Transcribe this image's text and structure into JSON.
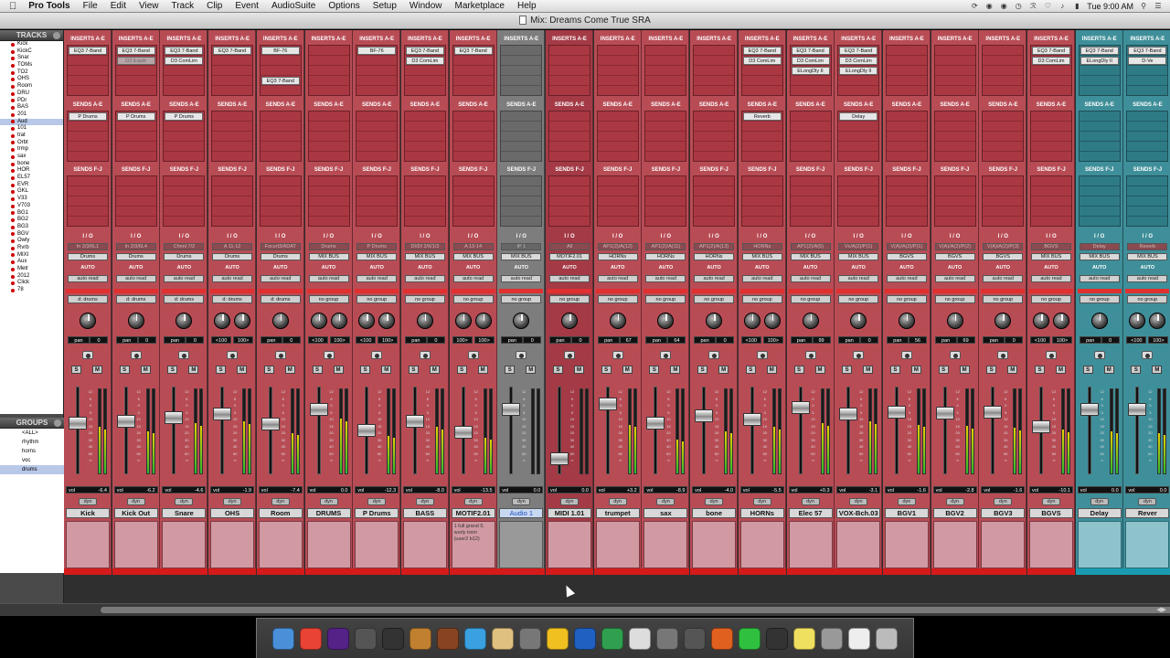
{
  "menubar": {
    "app_name": "Pro Tools",
    "items": [
      "File",
      "Edit",
      "View",
      "Track",
      "Clip",
      "Event",
      "AudioSuite",
      "Options",
      "Setup",
      "Window",
      "Marketplace",
      "Help"
    ],
    "clock": "Tue 9:00 AM"
  },
  "window": {
    "title": "Mix: Dreams Come True SRA"
  },
  "sidebar": {
    "tracks_header": "TRACKS",
    "tracks": [
      "Kick",
      "KickC",
      "Snar",
      "TOMs",
      "TO2",
      "OHS",
      "Room",
      "DRU",
      "PDr",
      "BAS",
      "201",
      "Aud",
      "101",
      "trat",
      "Orbt",
      "trmp",
      "sax",
      "bone",
      "HOR",
      "EL57",
      "EVR",
      "GKL",
      "V33",
      "V703",
      "BG1",
      "BG2",
      "BG3",
      "BGV",
      "Owly",
      "Rvrb",
      "MIXI",
      "Aux",
      "Metr",
      "2012",
      "Click",
      "78"
    ],
    "groups_header": "GROUPS",
    "groups": [
      "<ALL>",
      "rhythm",
      "horns",
      "voc",
      "drums"
    ]
  },
  "labels": {
    "inserts": "INSERTS A-E",
    "sends_ae": "SENDS A-E",
    "sends_fj": "SENDS F-J",
    "io": "I / O",
    "auto": "AUTO",
    "vol": "vol",
    "dyn": "dyn",
    "S": "S",
    "M": "M"
  },
  "strips": [
    {
      "name": "Kick",
      "inserts": [
        "EQ3 7-Band"
      ],
      "sends": [
        "P Drums"
      ],
      "input": "In 2/3/6L1",
      "output": "Drums",
      "auto": "auto read",
      "group": "d: drums",
      "pan": [
        "pan",
        "0"
      ],
      "vol": "-6.4",
      "fader": 40,
      "meter": 55,
      "color": "red"
    },
    {
      "name": "Kick Out",
      "inserts": [
        "EQ3 7-Band",
        "D3 Expdr"
      ],
      "sends": [
        "P Drums"
      ],
      "input": "In 2/3/6L4",
      "output": "Drums",
      "auto": "auto read",
      "group": "d: drums",
      "pan": [
        "pan",
        "0"
      ],
      "vol": "-6.2",
      "fader": 38,
      "meter": 50,
      "color": "red"
    },
    {
      "name": "Snare",
      "inserts": [
        "EQ3 7-Band",
        "D3 ComLim"
      ],
      "sends": [
        "P Drums"
      ],
      "input": "Chnnl 7/2",
      "output": "Drums",
      "auto": "auto read",
      "group": "d: drums",
      "pan": [
        "pan",
        "0"
      ],
      "vol": "-4.6",
      "fader": 33,
      "meter": 60,
      "color": "red"
    },
    {
      "name": "OHS",
      "inserts": [
        "EQ3 7-Band"
      ],
      "sends": [],
      "input": "A 11-12",
      "output": "Drums",
      "auto": "auto read",
      "group": "d: drums",
      "pan": [
        "<100",
        "100>"
      ],
      "vol": "-1.9",
      "fader": 28,
      "meter": 62,
      "color": "red",
      "stereo": true
    },
    {
      "name": "Room",
      "inserts": [
        "BF-76",
        "",
        "",
        "EQ3 7-Band"
      ],
      "sends": [],
      "input": "Focsrt3/ADAT",
      "output": "Drums",
      "auto": "auto read",
      "group": "d: drums",
      "pan": [
        "pan",
        "0"
      ],
      "vol": "-7.4",
      "fader": 42,
      "meter": 48,
      "color": "red"
    },
    {
      "name": "DRUMS",
      "inserts": [],
      "sends": [],
      "input": "Drums",
      "output": "MIX BUS",
      "auto": "auto read",
      "group": "no group",
      "pan": [
        "<100",
        "100>"
      ],
      "vol": "0.0",
      "fader": 22,
      "meter": 65,
      "color": "red",
      "stereo": true
    },
    {
      "name": "P Drums",
      "inserts": [
        "BF-76"
      ],
      "sends": [],
      "input": "P Drums",
      "output": "MIX BUS",
      "auto": "auto read",
      "group": "no group",
      "pan": [
        "<100",
        "100>"
      ],
      "vol": "-12.3",
      "fader": 50,
      "meter": 45,
      "color": "red",
      "stereo": true
    },
    {
      "name": "BASS",
      "inserts": [
        "EQ3 7-Band",
        "D3 ComLim"
      ],
      "sends": [],
      "input": "DI/DI 2/6/1/3",
      "output": "MIX BUS",
      "auto": "auto read",
      "group": "no group",
      "pan": [
        "pan",
        "0"
      ],
      "vol": "-8.0",
      "fader": 38,
      "meter": 55,
      "color": "red"
    },
    {
      "name": "MOTIF2.01",
      "inserts": [
        "EQ3 7-Band"
      ],
      "sends": [],
      "input": "A 13-14",
      "output": "MIX BUS",
      "auto": "auto read",
      "group": "no group",
      "pan": [
        "100>",
        "100>"
      ],
      "vol": "-13.5",
      "fader": 52,
      "meter": 42,
      "color": "red",
      "stereo": true,
      "comment": "1 full grand 5. wurly trem (user2 b12)"
    },
    {
      "name": "Audio 1",
      "inserts": [],
      "sends": [],
      "input": "IP 1",
      "output": "MIX BUS",
      "auto": "auto read",
      "group": "no group",
      "pan": [
        "pan",
        "0"
      ],
      "vol": "0.0",
      "fader": 22,
      "meter": 0,
      "color": "gray",
      "hl": true
    },
    {
      "name": "MIDI 1.01",
      "inserts": [],
      "sends": [],
      "input": "All",
      "output": "MOTIF2.01",
      "auto": "auto read",
      "group": "no group",
      "pan": [
        "pan",
        "0"
      ],
      "vol": "0.0",
      "fader": 88,
      "meter": 0,
      "color": "midi",
      "midi": true
    },
    {
      "name": "trumpet",
      "inserts": [],
      "sends": [],
      "input": "AP1(2)/A(12)",
      "output": "HORNs",
      "auto": "auto read",
      "group": "no group",
      "pan": [
        "pan",
        "67"
      ],
      "vol": "+3.2",
      "fader": 15,
      "meter": 58,
      "color": "red"
    },
    {
      "name": "sax",
      "inserts": [],
      "sends": [],
      "input": "AP1(2)/A(11)",
      "output": "HORNs",
      "auto": "auto read",
      "group": "no group",
      "pan": [
        "pan",
        "64"
      ],
      "vol": "-8.9",
      "fader": 40,
      "meter": 40,
      "color": "red"
    },
    {
      "name": "bone",
      "inserts": [],
      "sends": [],
      "input": "AP1(2)/A(13)",
      "output": "HORNs",
      "auto": "auto read",
      "group": "no group",
      "pan": [
        "pan",
        "0"
      ],
      "vol": "-4.0",
      "fader": 30,
      "meter": 50,
      "color": "red"
    },
    {
      "name": "HORNs",
      "inserts": [
        "EQ3 7-Band",
        "D3 ComLim"
      ],
      "sends": [
        "Reverb"
      ],
      "input": "HORNs",
      "output": "MIX BUS",
      "auto": "auto read",
      "group": "no group",
      "pan": [
        "<100",
        "100>"
      ],
      "vol": "-5.5",
      "fader": 35,
      "meter": 55,
      "color": "red",
      "stereo": true
    },
    {
      "name": "Elec 57",
      "inserts": [
        "EQ3 7-Band",
        "D3 ComLim",
        "ELongDly II"
      ],
      "sends": [],
      "input": "AP1(2)/A(5)",
      "output": "MIX BUS",
      "auto": "auto read",
      "group": "no group",
      "pan": [
        "pan",
        "99"
      ],
      "vol": "+0.3",
      "fader": 20,
      "meter": 60,
      "color": "red"
    },
    {
      "name": "VOX-Bch.03",
      "inserts": [
        "EQ3 7-Band",
        "D3 ComLim",
        "ELongDly II"
      ],
      "sends": [
        "Delay"
      ],
      "input": "Vc/A(2)/P(1)",
      "output": "MIX BUS",
      "auto": "auto read",
      "group": "no group",
      "pan": [
        "pan",
        "0"
      ],
      "vol": "-3.1",
      "fader": 28,
      "meter": 62,
      "color": "red"
    },
    {
      "name": "BGV1",
      "inserts": [],
      "sends": [],
      "input": "V(A)/A(2)/P(1)",
      "output": "BGVS",
      "auto": "auto read",
      "group": "no group",
      "pan": [
        "pan",
        "56"
      ],
      "vol": "-1.6",
      "fader": 25,
      "meter": 58,
      "color": "red"
    },
    {
      "name": "BGV2",
      "inserts": [],
      "sends": [],
      "input": "V(A)/A(2)/P(2)",
      "output": "BGVS",
      "auto": "auto read",
      "group": "no group",
      "pan": [
        "pan",
        "69"
      ],
      "vol": "-2.8",
      "fader": 27,
      "meter": 56,
      "color": "red"
    },
    {
      "name": "BGV3",
      "inserts": [],
      "sends": [],
      "input": "V(A)/A(2)/P(3)",
      "output": "BGVS",
      "auto": "auto read",
      "group": "no group",
      "pan": [
        "pan",
        "0"
      ],
      "vol": "-1.6",
      "fader": 25,
      "meter": 54,
      "color": "red"
    },
    {
      "name": "BGVS",
      "inserts": [
        "EQ3 7-Band",
        "D3 ComLim"
      ],
      "sends": [],
      "input": "BGVS",
      "output": "MIX BUS",
      "auto": "auto read",
      "group": "no group",
      "pan": [
        "<100",
        "100>"
      ],
      "vol": "-10.1",
      "fader": 45,
      "meter": 52,
      "color": "red",
      "stereo": true
    },
    {
      "name": "Delay",
      "inserts": [
        "EQ3 7-Band",
        "ELongDly II"
      ],
      "sends": [],
      "input": "Delay",
      "output": "MIX BUS",
      "auto": "auto read",
      "group": "no group",
      "pan": [
        "pan",
        "0"
      ],
      "vol": "0.0",
      "fader": 22,
      "meter": 50,
      "color": "teal"
    },
    {
      "name": "Rever",
      "inserts": [
        "EQ3 7-Band",
        "D-Ve"
      ],
      "sends": [],
      "input": "Reverb",
      "output": "MIX BUS",
      "auto": "auto read",
      "group": "no group",
      "pan": [
        "<100",
        "100>"
      ],
      "vol": "0.0",
      "fader": 22,
      "meter": 48,
      "color": "teal",
      "stereo": true
    }
  ]
}
